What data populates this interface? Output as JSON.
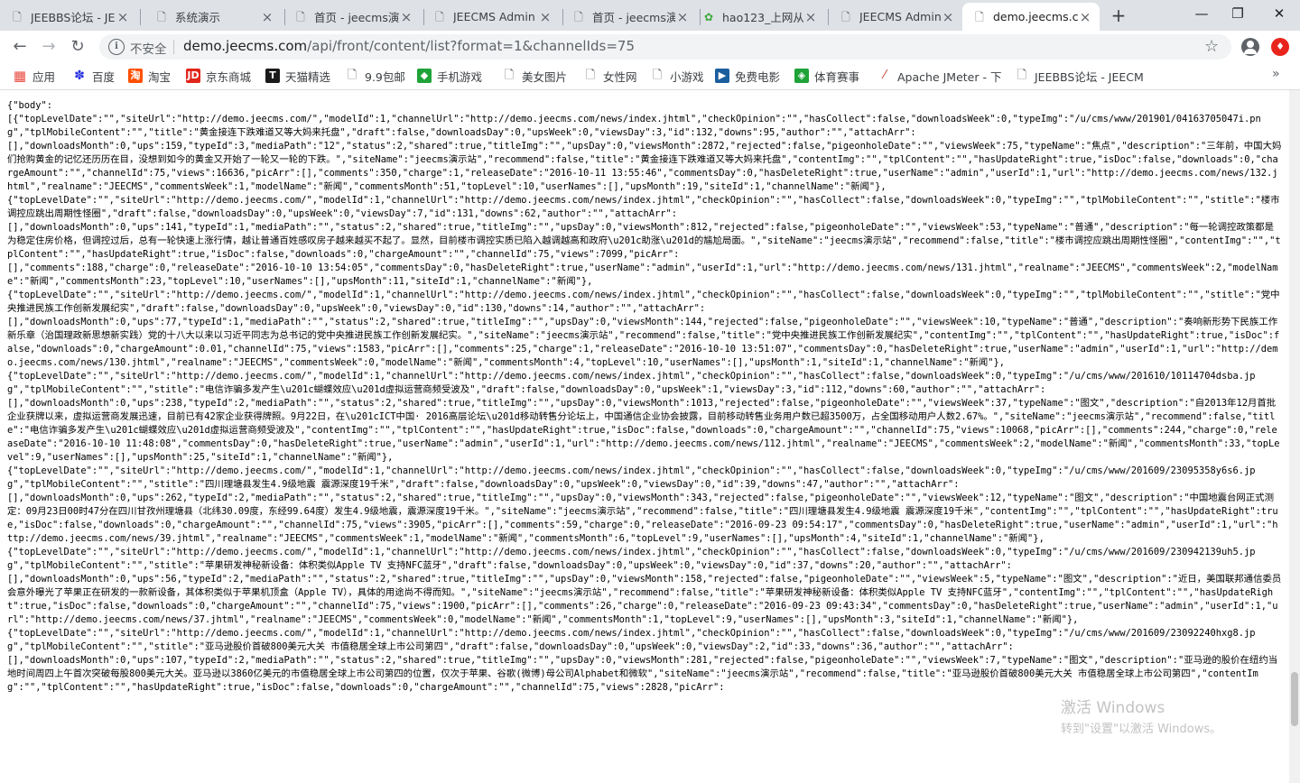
{
  "tabs": [
    {
      "title": "JEEBBS论坛 - JE",
      "icon": "document-icon",
      "active": false
    },
    {
      "title": "系统演示",
      "icon": "document-icon",
      "active": false
    },
    {
      "title": "首页 - jeecms演",
      "icon": "document-icon",
      "active": false
    },
    {
      "title": "JEECMS Admin",
      "icon": "document-icon",
      "active": false
    },
    {
      "title": "首页 - jeecms演",
      "icon": "document-icon",
      "active": false
    },
    {
      "title": "hao123_上网从",
      "icon": "hao123-icon",
      "active": false
    },
    {
      "title": "JEECMS Admin",
      "icon": "document-icon",
      "active": false
    },
    {
      "title": "demo.jeecms.c",
      "icon": "document-icon",
      "active": true
    }
  ],
  "window_controls": {
    "minimize": "—",
    "restore": "❐",
    "close": "✕"
  },
  "toolbar": {
    "security_label": "不安全",
    "url_host": "demo.jeecms.com",
    "url_rest": "/api/front/content/list?format=1&channelIds=75"
  },
  "bookmarks": [
    {
      "label": "应用",
      "icon": "apps-icon",
      "color": "#e8453c"
    },
    {
      "label": "百度",
      "icon": "baidu-icon",
      "color": "#2932e1"
    },
    {
      "label": "淘宝",
      "icon": "taobao-icon",
      "color": "#ff5000"
    },
    {
      "label": "京东商城",
      "icon": "jd-icon",
      "color": "#e1251b"
    },
    {
      "label": "天猫精选",
      "icon": "tmall-icon",
      "color": "#1a1a1a"
    },
    {
      "label": "9.9包邮",
      "icon": "document-icon",
      "color": "#ffffff"
    },
    {
      "label": "手机游戏",
      "icon": "game-icon",
      "color": "#1fa338"
    },
    {
      "label": "美女图片",
      "icon": "document-icon",
      "color": "#ffffff"
    },
    {
      "label": "女性网",
      "icon": "document-icon",
      "color": "#ffffff"
    },
    {
      "label": "小游戏",
      "icon": "document-icon",
      "color": "#ffffff"
    },
    {
      "label": "免费电影",
      "icon": "movie-icon",
      "color": "#1b5e9e"
    },
    {
      "label": "体育赛事",
      "icon": "sports-icon",
      "color": "#1fa338"
    },
    {
      "label": "Apache JMeter - 下",
      "icon": "jmeter-icon",
      "color": "#ffffff"
    },
    {
      "label": "JEEBBS论坛 - JEECM",
      "icon": "document-icon",
      "color": "#ffffff"
    }
  ],
  "bookmarks_more": "»",
  "json_body": "{\"body\":\n[{\"topLevelDate\":\"\",\"siteUrl\":\"http://demo.jeecms.com/\",\"modelId\":1,\"channelUrl\":\"http://demo.jeecms.com/news/index.jhtml\",\"checkOpinion\":\"\",\"hasCollect\":false,\"downloadsWeek\":0,\"typeImg\":\"/u/cms/www/201901/04163705047i.png\",\"tplMobileContent\":\"\",\"title\":\"黄金接连下跌难道又等大妈来托盘\",\"draft\":false,\"downloadsDay\":0,\"upsWeek\":0,\"viewsDay\":3,\"id\":132,\"downs\":95,\"author\":\"\",\"attachArr\":\n[],\"downloadsMonth\":0,\"ups\":159,\"typeId\":3,\"mediaPath\":\"12\",\"status\":2,\"shared\":true,\"titleImg\":\"\",\"upsDay\":0,\"viewsMonth\":2872,\"rejected\":false,\"pigeonholeDate\":\"\",\"viewsWeek\":75,\"typeName\":\"焦点\",\"description\":\"三年前，中国大妈们抢购黄金的记忆还历历在目，没想到如今的黄金又开始了一轮又一轮的下跌。\",\"siteName\":\"jeecms演示站\",\"recommend\":false,\"title\":\"黄金接连下跌难道又等大妈来托盘\",\"contentImg\":\"\",\"tplContent\":\"\",\"hasUpdateRight\":true,\"isDoc\":false,\"downloads\":0,\"chargeAmount\":\"\",\"channelId\":75,\"views\":16636,\"picArr\":[],\"comments\":350,\"charge\":1,\"releaseDate\":\"2016-10-11 13:55:46\",\"commentsDay\":0,\"hasDeleteRight\":true,\"userName\":\"admin\",\"userId\":1,\"url\":\"http://demo.jeecms.com/news/132.jhtml\",\"realname\":\"JEECMS\",\"commentsWeek\":1,\"modelName\":\"新闻\",\"commentsMonth\":51,\"topLevel\":10,\"userNames\":[],\"upsMonth\":19,\"siteId\":1,\"channelName\":\"新闻\"},\n{\"topLevelDate\":\"\",\"siteUrl\":\"http://demo.jeecms.com/\",\"modelId\":1,\"channelUrl\":\"http://demo.jeecms.com/news/index.jhtml\",\"checkOpinion\":\"\",\"hasCollect\":false,\"downloadsWeek\":0,\"typeImg\":\"\",\"tplMobileContent\":\"\",\"stitle\":\"楼市调控应跳出周期性怪圈\",\"draft\":false,\"downloadsDay\":0,\"upsWeek\":0,\"viewsDay\":7,\"id\":131,\"downs\":62,\"author\":\"\",\"attachArr\":\n[],\"downloadsMonth\":0,\"ups\":141,\"typeId\":1,\"mediaPath\":\"\",\"status\":2,\"shared\":true,\"titleImg\":\"\",\"upsDay\":0,\"viewsMonth\":812,\"rejected\":false,\"pigeonholeDate\":\"\",\"viewsWeek\":53,\"typeName\":\"普通\",\"description\":\"每一轮调控政策都是为稳定住房价格，但调控过后，总有一轮快速上涨行情，越让普通百姓感叹房子越来越买不起了。显然，目前楼市调控实质已陷入越调越高和政府\\u201c助涨\\u201d的尴尬局面。\",\"siteName\":\"jeecms演示站\",\"recommend\":false,\"title\":\"楼市调控应跳出周期性怪圈\",\"contentImg\":\"\",\"tplContent\":\"\",\"hasUpdateRight\":true,\"isDoc\":false,\"downloads\":0,\"chargeAmount\":\"\",\"channelId\":75,\"views\":7099,\"picArr\":\n[],\"comments\":188,\"charge\":0,\"releaseDate\":\"2016-10-10 13:54:05\",\"commentsDay\":0,\"hasDeleteRight\":true,\"userName\":\"admin\",\"userId\":1,\"url\":\"http://demo.jeecms.com/news/131.jhtml\",\"realname\":\"JEECMS\",\"commentsWeek\":2,\"modelName\":\"新闻\",\"commentsMonth\":23,\"topLevel\":10,\"userNames\":[],\"upsMonth\":11,\"siteId\":1,\"channelName\":\"新闻\"},\n{\"topLevelDate\":\"\",\"siteUrl\":\"http://demo.jeecms.com/\",\"modelId\":1,\"channelUrl\":\"http://demo.jeecms.com/news/index.jhtml\",\"checkOpinion\":\"\",\"hasCollect\":false,\"downloadsWeek\":0,\"typeImg\":\"\",\"tplMobileContent\":\"\",\"stitle\":\"党中央推进民族工作创新发展纪实\",\"draft\":false,\"downloadsDay\":0,\"upsWeek\":0,\"viewsDay\":0,\"id\":130,\"downs\":14,\"author\":\"\",\"attachArr\":\n[],\"downloadsMonth\":0,\"ups\":77,\"typeId\":1,\"mediaPath\":\"\",\"status\":2,\"shared\":true,\"titleImg\":\"\",\"upsDay\":0,\"viewsMonth\":144,\"rejected\":false,\"pigeonholeDate\":\"\",\"viewsWeek\":10,\"typeName\":\"普通\",\"description\":\"奏响新形势下民族工作新乐章（治国理政新思想新实践）党的十八大以来以习近平同志为总书记的党中央推进民族工作创新发展纪实。\",\"siteName\":\"jeecms演示站\",\"recommend\":false,\"title\":\"党中央推进民族工作创新发展纪实\",\"contentImg\":\"\",\"tplContent\":\"\",\"hasUpdateRight\":true,\"isDoc\":false,\"downloads\":0,\"chargeAmount\":0.01,\"channelId\":75,\"views\":1583,\"picArr\":[],\"comments\":25,\"charge\":1,\"releaseDate\":\"2016-10-10 13:51:07\",\"commentsDay\":0,\"hasDeleteRight\":true,\"userName\":\"admin\",\"userId\":1,\"url\":\"http://demo.jeecms.com/news/130.jhtml\",\"realname\":\"JEECMS\",\"commentsWeek\":0,\"modelName\":\"新闻\",\"commentsMonth\":4,\"topLevel\":10,\"userNames\":[],\"upsMonth\":1,\"siteId\":1,\"channelName\":\"新闻\"},\n{\"topLevelDate\":\"\",\"siteUrl\":\"http://demo.jeecms.com/\",\"modelId\":1,\"channelUrl\":\"http://demo.jeecms.com/news/index.jhtml\",\"checkOpinion\":\"\",\"hasCollect\":false,\"downloadsWeek\":0,\"typeImg\":\"/u/cms/www/201610/10114704dsba.jpg\",\"tplMobileContent\":\"\",\"stitle\":\"电信诈骗多发产生\\u201c蝴蝶效应\\u201d虚拟运营商频受波及\",\"draft\":false,\"downloadsDay\":0,\"upsWeek\":1,\"viewsDay\":3,\"id\":112,\"downs\":60,\"author\":\"\",\"attachArr\":\n[],\"downloadsMonth\":0,\"ups\":238,\"typeId\":2,\"mediaPath\":\"\",\"status\":2,\"shared\":true,\"titleImg\":\"\",\"upsDay\":0,\"viewsMonth\":1013,\"rejected\":false,\"pigeonholeDate\":\"\",\"viewsWeek\":37,\"typeName\":\"图文\",\"description\":\"自2013年12月首批企业获牌以来，虚拟运营商发展迅速，目前已有42家企业获得牌照。9月22日，在\\u201cICT中国· 2016高层论坛\\u201d移动转售分论坛上，中国通信企业协会披露，目前移动转售业务用户数已超3500万，占全国移动用户人数2.67%。\",\"siteName\":\"jeecms演示站\",\"recommend\":false,\"title\":\"电信诈骗多发产生\\u201c蝴蝶效应\\u201d虚拟运营商频受波及\",\"contentImg\":\"\",\"tplContent\":\"\",\"hasUpdateRight\":true,\"isDoc\":false,\"downloads\":0,\"chargeAmount\":\"\",\"channelId\":75,\"views\":10068,\"picArr\":[],\"comments\":244,\"charge\":0,\"releaseDate\":\"2016-10-10 11:48:08\",\"commentsDay\":0,\"hasDeleteRight\":true,\"userName\":\"admin\",\"userId\":1,\"url\":\"http://demo.jeecms.com/news/112.jhtml\",\"realname\":\"JEECMS\",\"commentsWeek\":2,\"modelName\":\"新闻\",\"commentsMonth\":33,\"topLevel\":9,\"userNames\":[],\"upsMonth\":25,\"siteId\":1,\"channelName\":\"新闻\"},\n{\"topLevelDate\":\"\",\"siteUrl\":\"http://demo.jeecms.com/\",\"modelId\":1,\"channelUrl\":\"http://demo.jeecms.com/news/index.jhtml\",\"checkOpinion\":\"\",\"hasCollect\":false,\"downloadsWeek\":0,\"typeImg\":\"/u/cms/www/201609/23095358y6s6.jpg\",\"tplMobileContent\":\"\",\"stitle\":\"四川理塘县发生4.9级地震 震源深度19千米\",\"draft\":false,\"downloadsDay\":0,\"upsWeek\":0,\"viewsDay\":0,\"id\":39,\"downs\":47,\"author\":\"\",\"attachArr\":\n[],\"downloadsMonth\":0,\"ups\":262,\"typeId\":2,\"mediaPath\":\"\",\"status\":2,\"shared\":true,\"titleImg\":\"\",\"upsDay\":0,\"viewsMonth\":343,\"rejected\":false,\"pigeonholeDate\":\"\",\"viewsWeek\":12,\"typeName\":\"图文\",\"description\":\"中国地震台网正式测定：09月23日00时47分在四川甘孜州理塘县（北纬30.09度，东经99.64度）发生4.9级地震，震源深度19千米。\",\"siteName\":\"jeecms演示站\",\"recommend\":false,\"title\":\"四川理塘县发生4.9级地震 震源深度19千米\",\"contentImg\":\"\",\"tplContent\":\"\",\"hasUpdateRight\":true,\"isDoc\":false,\"downloads\":0,\"chargeAmount\":\"\",\"channelId\":75,\"views\":3905,\"picArr\":[],\"comments\":59,\"charge\":0,\"releaseDate\":\"2016-09-23 09:54:17\",\"commentsDay\":0,\"hasDeleteRight\":true,\"userName\":\"admin\",\"userId\":1,\"url\":\"http://demo.jeecms.com/news/39.jhtml\",\"realname\":\"JEECMS\",\"commentsWeek\":1,\"modelName\":\"新闻\",\"commentsMonth\":6,\"topLevel\":9,\"userNames\":[],\"upsMonth\":4,\"siteId\":1,\"channelName\":\"新闻\"},\n{\"topLevelDate\":\"\",\"siteUrl\":\"http://demo.jeecms.com/\",\"modelId\":1,\"channelUrl\":\"http://demo.jeecms.com/news/index.jhtml\",\"checkOpinion\":\"\",\"hasCollect\":false,\"downloadsWeek\":0,\"typeImg\":\"/u/cms/www/201609/230942139uh5.jpg\",\"tplMobileContent\":\"\",\"stitle\":\"苹果研发神秘新设备：体积类似Apple TV 支持NFC蓝牙\",\"draft\":false,\"downloadsDay\":0,\"upsWeek\":0,\"viewsDay\":0,\"id\":37,\"downs\":20,\"author\":\"\",\"attachArr\":\n[],\"downloadsMonth\":0,\"ups\":56,\"typeId\":2,\"mediaPath\":\"\",\"status\":2,\"shared\":true,\"titleImg\":\"\",\"upsDay\":0,\"viewsMonth\":158,\"rejected\":false,\"pigeonholeDate\":\"\",\"viewsWeek\":5,\"typeName\":\"图文\",\"description\":\"近日，美国联邦通信委员会意外曝光了苹果正在研发的一款新设备，其体积类似于苹果机顶盒（Apple TV），具体的用途尚不得而知。\",\"siteName\":\"jeecms演示站\",\"recommend\":false,\"title\":\"苹果研发神秘新设备：体积类似Apple TV 支持NFC蓝牙\",\"contentImg\":\"\",\"tplContent\":\"\",\"hasUpdateRight\":true,\"isDoc\":false,\"downloads\":0,\"chargeAmount\":\"\",\"channelId\":75,\"views\":1900,\"picArr\":[],\"comments\":26,\"charge\":0,\"releaseDate\":\"2016-09-23 09:43:34\",\"commentsDay\":0,\"hasDeleteRight\":true,\"userName\":\"admin\",\"userId\":1,\"url\":\"http://demo.jeecms.com/news/37.jhtml\",\"realname\":\"JEECMS\",\"commentsWeek\":0,\"modelName\":\"新闻\",\"commentsMonth\":1,\"topLevel\":9,\"userNames\":[],\"upsMonth\":3,\"siteId\":1,\"channelName\":\"新闻\"},\n{\"topLevelDate\":\"\",\"siteUrl\":\"http://demo.jeecms.com/\",\"modelId\":1,\"channelUrl\":\"http://demo.jeecms.com/news/index.jhtml\",\"checkOpinion\":\"\",\"hasCollect\":false,\"downloadsWeek\":0,\"typeImg\":\"/u/cms/www/201609/23092240hxg8.jpg\",\"tplMobileContent\":\"\",\"stitle\":\"亚马逊股价首破800美元大关 市值稳居全球上市公司第四\",\"draft\":false,\"downloadsDay\":0,\"upsWeek\":0,\"viewsDay\":2,\"id\":33,\"downs\":36,\"author\":\"\",\"attachArr\":\n[],\"downloadsMonth\":0,\"ups\":107,\"typeId\":2,\"mediaPath\":\"\",\"status\":2,\"shared\":true,\"titleImg\":\"\",\"upsDay\":0,\"viewsMonth\":281,\"rejected\":false,\"pigeonholeDate\":\"\",\"viewsWeek\":7,\"typeName\":\"图文\",\"description\":\"亚马逊的股价在纽约当地时间周四上午首次突破每股800美元大关。亚马逊以3860亿美元的市值稳居全球上市公司第四的位置，仅次于苹果、谷歌(微博)母公司Alphabet和微软\",\"siteName\":\"jeecms演示站\",\"recommend\":false,\"title\":\"亚马逊股价首破800美元大关 市值稳居全球上市公司第四\",\"contentImg\":\"\",\"tplContent\":\"\",\"hasUpdateRight\":true,\"isDoc\":false,\"downloads\":0,\"chargeAmount\":\"\",\"channelId\":75,\"views\":2828,\"picArr\":",
  "watermark": {
    "title": "激活 Windows",
    "subtitle": "转到\"设置\"以激活 Windows。"
  }
}
